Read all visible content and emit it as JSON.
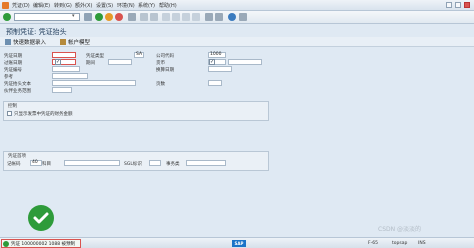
{
  "menu": {
    "items": [
      "凭证(D)",
      "编辑(E)",
      "转到(G)",
      "额外(X)",
      "设置(S)",
      "环境(N)",
      "系统(Y)",
      "帮助(H)"
    ]
  },
  "toolbar": {
    "command_value": ""
  },
  "screen": {
    "title": "预制凭证: 凭证抬头"
  },
  "app_toolbar": {
    "fast_entry": "快速数据录入",
    "account_model": "帐户模型"
  },
  "header": {
    "doc_date_label": "凭证日期",
    "doc_date_value": "",
    "doc_type_label": "凭证类型",
    "doc_type_value": "SA",
    "company_label": "公司代码",
    "company_value": "1000",
    "posting_date_label": "过账日期",
    "posting_date_value": "",
    "period_label": "期间",
    "period_value": "",
    "currency_label": "货币",
    "currency_value": "",
    "doc_number_label": "凭证编号",
    "doc_number_value": "",
    "translation_date_label": "换算日期",
    "translation_date_value": "",
    "reference_label": "参考",
    "reference_value": "",
    "header_text_label": "凭证抬头文本",
    "header_text_value": "",
    "trading_partner_label": "伙伴业务范围",
    "trading_partner_value": "",
    "pages_label": "页数",
    "pages_value": ""
  },
  "control": {
    "title": "控制",
    "only_tax_label": "只显示发票中凭证的财务金额"
  },
  "first_item": {
    "title": "凭证首项",
    "posting_key_label": "记帐码",
    "posting_key_value": "40",
    "account_label": "科目",
    "account_value": "",
    "sgl_label": "SGL标识",
    "sgl_value": "",
    "trans_type_label": "事务类",
    "trans_type_value": ""
  },
  "statusbar": {
    "message": "凭证 100000002 1088 被预制",
    "tcode": "F-65",
    "server": "topsap",
    "mode": "INS"
  },
  "watermark": "CSDN @淡淡的"
}
